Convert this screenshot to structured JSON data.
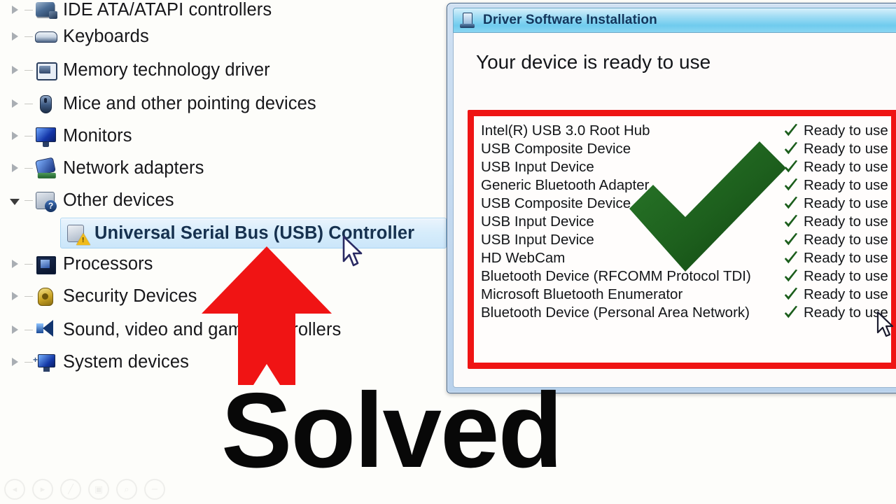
{
  "colors": {
    "page_background": "#fdfdfa",
    "accent_red": "#ef1414",
    "accent_green": "#1c5e1c",
    "selection_blue": "#cbe6fa",
    "title_text": "#13365c"
  },
  "device_manager": {
    "tree": [
      {
        "label": "IDE ATA/ATAPI controllers",
        "icon": "ide-controller-icon",
        "expander": "collapsed",
        "selected": false,
        "clipped_top": true
      },
      {
        "label": "Keyboards",
        "icon": "keyboard-icon",
        "expander": "collapsed",
        "selected": false
      },
      {
        "label": "Memory technology driver",
        "icon": "memory-technology-icon",
        "expander": "collapsed",
        "selected": false
      },
      {
        "label": "Mice and other pointing devices",
        "icon": "mouse-icon",
        "expander": "collapsed",
        "selected": false
      },
      {
        "label": "Monitors",
        "icon": "monitor-icon",
        "expander": "collapsed",
        "selected": false
      },
      {
        "label": "Network adapters",
        "icon": "network-adapter-icon",
        "expander": "collapsed",
        "selected": false
      },
      {
        "label": "Other devices",
        "icon": "other-devices-icon",
        "expander": "expanded",
        "selected": false
      },
      {
        "label": "Universal Serial Bus (USB) Controller",
        "icon": "unknown-device-warning-icon",
        "expander": "none",
        "selected": true
      },
      {
        "label": "Processors",
        "icon": "processor-icon",
        "expander": "collapsed",
        "selected": false
      },
      {
        "label": "Security Devices",
        "icon": "security-device-icon",
        "expander": "collapsed",
        "selected": false
      },
      {
        "label": "Sound, video and game controllers",
        "icon": "sound-video-icon",
        "expander": "collapsed",
        "selected": false
      },
      {
        "label": "System devices",
        "icon": "system-device-icon",
        "expander": "collapsed",
        "selected": false
      }
    ]
  },
  "dialog": {
    "title": "Driver Software Installation",
    "title_icon": "driver-install-icon",
    "heading": "Your device is ready to use",
    "status_label": "Ready to use",
    "status_icon": "green-check-icon",
    "devices": [
      {
        "name": "Intel(R) USB 3.0 Root Hub",
        "status": "Ready to use"
      },
      {
        "name": "USB Composite Device",
        "status": "Ready to use"
      },
      {
        "name": "USB Input Device",
        "status": "Ready to use"
      },
      {
        "name": "Generic Bluetooth Adapter",
        "status": "Ready to use"
      },
      {
        "name": "USB Composite Device",
        "status": "Ready to use"
      },
      {
        "name": "USB Input Device",
        "status": "Ready to use"
      },
      {
        "name": "USB Input Device",
        "status": "Ready to use"
      },
      {
        "name": "HD WebCam",
        "status": "Ready to use"
      },
      {
        "name": "Bluetooth Device (RFCOMM Protocol TDI)",
        "status": "Ready to use"
      },
      {
        "name": "Microsoft Bluetooth Enumerator",
        "status": "Ready to use"
      },
      {
        "name": "Bluetooth Device (Personal Area Network)",
        "status": "Ready to use"
      }
    ]
  },
  "annotations": {
    "solved_text": "Solved",
    "red_arrow": "red-up-arrow-annotation",
    "green_check": "large-green-check-annotation"
  },
  "watermark": {
    "icons": [
      "prev-icon",
      "next-icon",
      "pen-icon",
      "camera-icon",
      "zoom-icon",
      "minus-icon"
    ],
    "glyphs": [
      "◂",
      "▸",
      "╱",
      "▣",
      "⌕",
      "−"
    ]
  }
}
